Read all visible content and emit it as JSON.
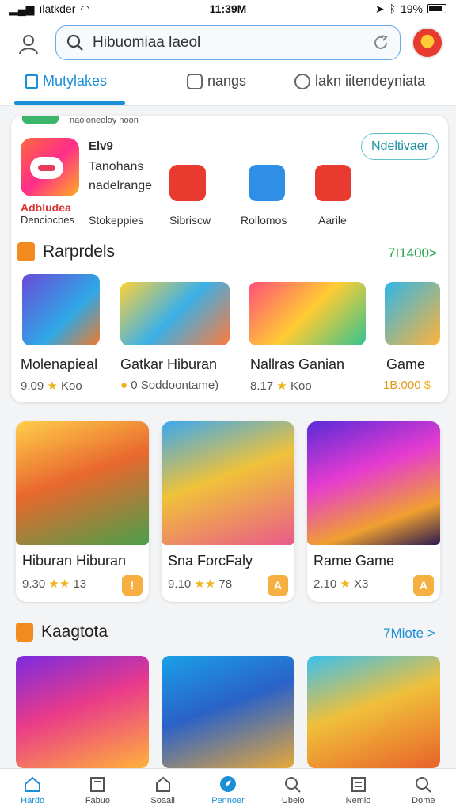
{
  "status_bar": {
    "carrier": "ılatkder",
    "time": "11:39M",
    "battery": "19%"
  },
  "header": {
    "search": {
      "value": "Hibuomiaa laeol",
      "placeholder": "Hibuomiaa laeol"
    },
    "tabs": [
      {
        "label": "Mutylakes",
        "icon": "square-icon",
        "active": true
      },
      {
        "label": "nangs",
        "icon": "clock-icon",
        "active": false
      },
      {
        "label": "lakn iitendeyniata",
        "icon": "compass-icon",
        "active": false
      }
    ]
  },
  "featured": {
    "promo_text": "naoloneoloy noon",
    "app": {
      "name": "Elv9",
      "line1": "Tanohans",
      "line2": "nadelrange",
      "brand": "Adbludea",
      "caption": "Denciocbes"
    },
    "button": "Ndeltivaer",
    "mini_apps": [
      {
        "label": "Stokeppies",
        "color": "#e83a2e",
        "icon": "scissors-icon"
      },
      {
        "label": "Sibriscw",
        "color": "#e83a2e",
        "icon": "pencil-icon"
      },
      {
        "label": "Rollomos",
        "color": "#2f8fe6",
        "icon": "bird-icon"
      },
      {
        "label": "Aarile",
        "color": "#e83a2e",
        "icon": "hammer-icon"
      }
    ],
    "section_title": "Rarprdels",
    "see_more": "7I1400>",
    "games": [
      {
        "name": "Molenapieal",
        "rating": "9.09",
        "extra": "Koo"
      },
      {
        "name": "Gatkar Hiburan",
        "rating": "0",
        "extra": "Soddoontame)"
      },
      {
        "name": "Nallras Ganian",
        "rating": "8.17",
        "extra": "Koo"
      },
      {
        "name": "Game",
        "rating": "1B:000",
        "extra": ""
      }
    ]
  },
  "grid_row1": [
    {
      "name": "Hiburan Hiburan",
      "rating": "9.30",
      "extra": "13",
      "badge": "!"
    },
    {
      "name": "Sna ForcFaly",
      "rating": "9.10",
      "extra": "78",
      "badge": "A"
    },
    {
      "name": "Rame Game",
      "rating": "2.10",
      "extra": "X3",
      "badge": "A"
    }
  ],
  "section2": {
    "title": "Kaagtota",
    "see_more": "7Miote >"
  },
  "bottom_nav": [
    {
      "label": "Hardo",
      "icon": "home-icon",
      "active": true
    },
    {
      "label": "Fabuo",
      "icon": "book-icon",
      "active": false
    },
    {
      "label": "Soaail",
      "icon": "house-icon",
      "active": false
    },
    {
      "label": "Pennoer",
      "icon": "compass-icon",
      "active": true
    },
    {
      "label": "Ubeio",
      "icon": "search-icon",
      "active": false
    },
    {
      "label": "Nemio",
      "icon": "list-icon",
      "active": false
    },
    {
      "label": "Dome",
      "icon": "search-icon",
      "active": false
    }
  ]
}
